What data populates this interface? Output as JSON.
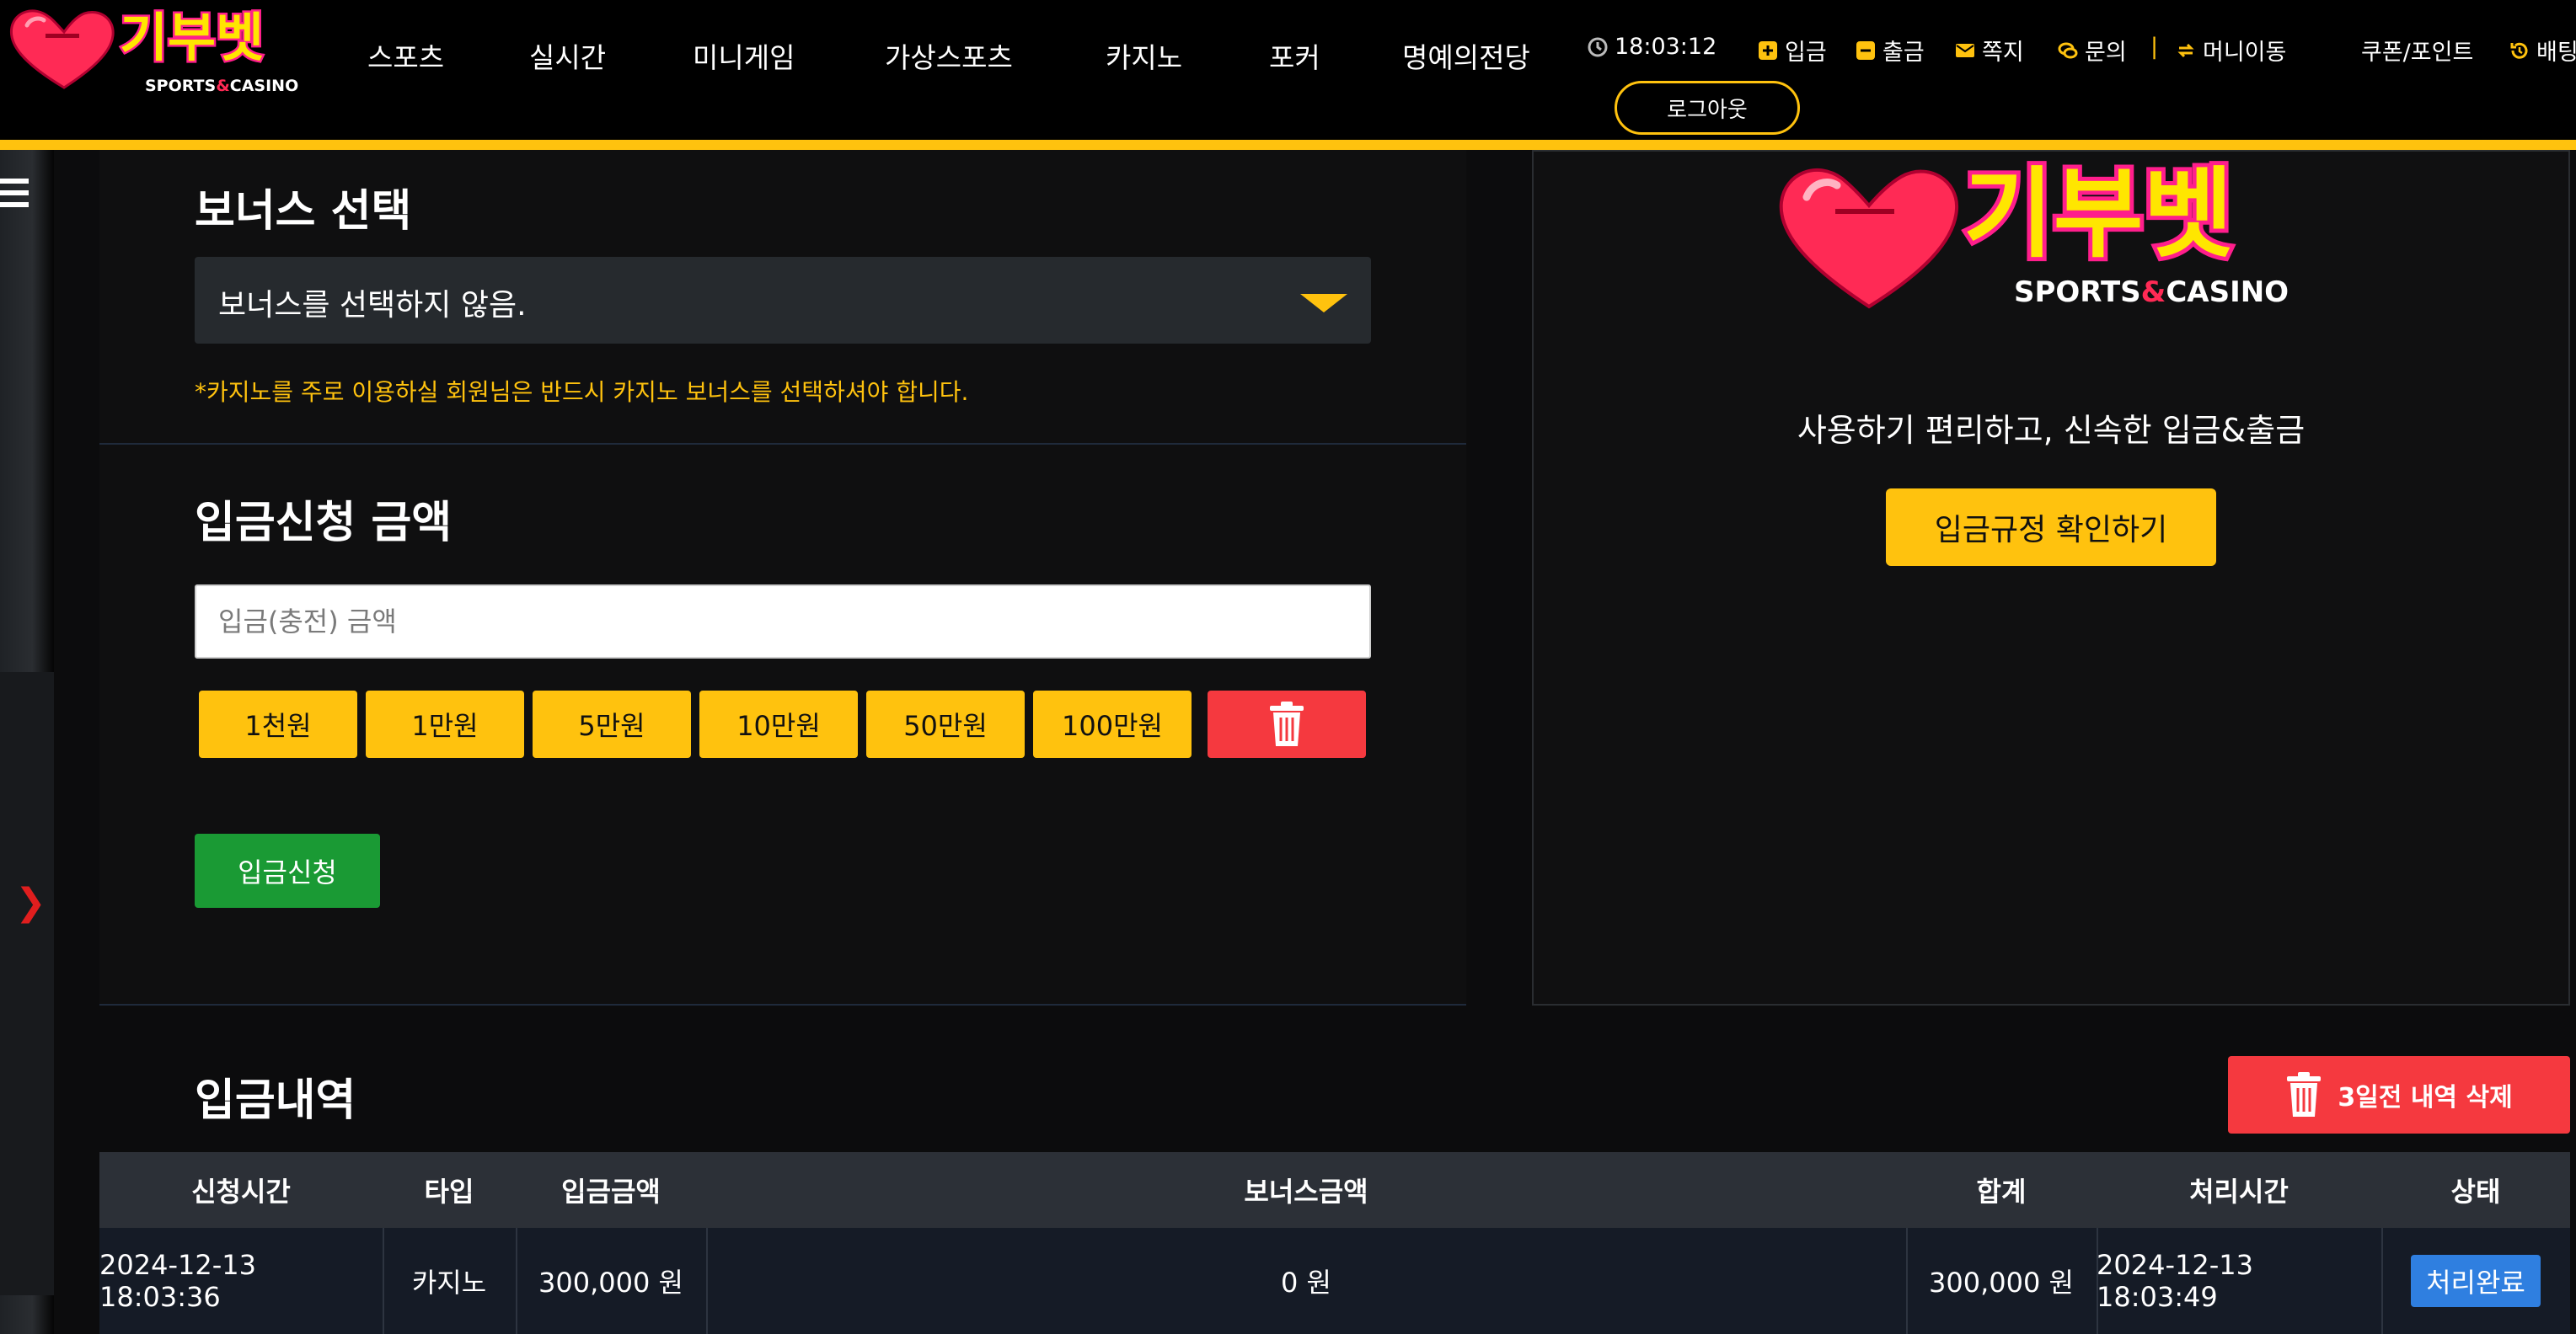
{
  "brand": {
    "name": "기부벳",
    "sub_sports": "SPORTS",
    "sub_amp": "&",
    "sub_casino": "CASINO"
  },
  "nav": [
    {
      "label": "스포츠"
    },
    {
      "label": "실시간"
    },
    {
      "label": "미니게임"
    },
    {
      "label": "가상스포츠"
    },
    {
      "label": "카지노"
    },
    {
      "label": "포커"
    },
    {
      "label": "명예의전당"
    }
  ],
  "topbar": {
    "time": "18:03:12",
    "deposit": "입금",
    "withdraw": "출금",
    "message": "쪽지",
    "inquiry": "문의",
    "separator": "|",
    "money_move": "머니이동",
    "coupon_point": "쿠폰/포인트",
    "history": "배팅"
  },
  "logout_label": "로그아웃",
  "bonus": {
    "title": "보너스 선택",
    "selected": "보너스를 선택하지 않음.",
    "notice": "*카지노를 주로 이용하실 회원님은 반드시 카지노 보너스를 선택하셔야 합니다."
  },
  "deposit_form": {
    "title": "입금신청 금액",
    "placeholder": "입금(충전) 금액",
    "quick_amounts": [
      "1천원",
      "1만원",
      "5만원",
      "10만원",
      "50만원",
      "100만원"
    ],
    "submit_label": "입금신청"
  },
  "right_panel": {
    "tagline": "사용하기 편리하고, 신속한 입금&출금",
    "rule_button": "입금규정 확인하기"
  },
  "history": {
    "title": "입금내역",
    "delete_label": "3일전 내역 삭제",
    "columns": [
      "신청시간",
      "타입",
      "입금금액",
      "보너스금액",
      "합계",
      "처리시간",
      "상태"
    ],
    "rows": [
      {
        "requested": "2024-12-13 18:03:36",
        "type": "카지노",
        "amount": "300,000 원",
        "bonus": "0 원",
        "total": "300,000 원",
        "processed": "2024-12-13 18:03:49",
        "status": "처리완료"
      }
    ]
  },
  "colors": {
    "accent": "#ffc20e",
    "danger": "#f5393f",
    "success": "#1a9a34",
    "status": "#2f7fe0"
  }
}
